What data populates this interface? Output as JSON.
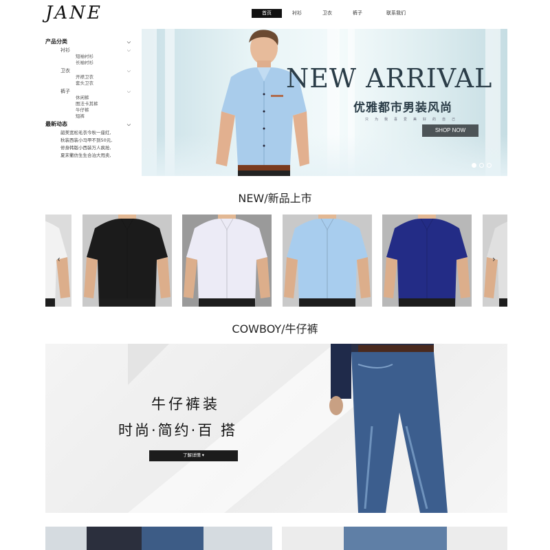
{
  "logo": "JANE",
  "nav": {
    "items": [
      {
        "label": "首页",
        "active": true
      },
      {
        "label": "衬衫",
        "active": false
      },
      {
        "label": "卫衣",
        "active": false
      },
      {
        "label": "裤子",
        "active": false
      },
      {
        "label": "联系我们",
        "active": false
      }
    ]
  },
  "sidebar": {
    "products_title": "产品分类",
    "categories": [
      {
        "label": "衬衫",
        "items": [
          "短袖衬衫",
          "长袖衬衫"
        ]
      },
      {
        "label": "卫衣",
        "items": [
          "开襟卫衣",
          "套头卫衣"
        ]
      },
      {
        "label": "裤子",
        "items": [
          "休闲裤",
          "图法卡其裤",
          "牛仔裤",
          "短裤"
        ]
      }
    ],
    "news_title": "最新动态",
    "news": [
      "韶美宽松毛衣今秋一座红,",
      "秋装西装小马甲不到50元,",
      "修身韩版小西装万人疯抢,",
      "夏末衢仿生生合泊大甩卖,"
    ]
  },
  "banner": {
    "title": "NEW ARRIVAL",
    "subtitle": "优雅都市男装风尚",
    "small_text": "只为我喜爱美好的自己",
    "button": "SHOP NOW"
  },
  "sections": {
    "new_title": "NEW/新品上市",
    "cowboy_title": "COWBOY/牛仔裤"
  },
  "carousel": {
    "shirts": [
      {
        "color": "#f2f2f2",
        "bg": "#dcdcdc"
      },
      {
        "color": "#1b1b1b",
        "bg": "#c9c9c9"
      },
      {
        "color": "#ecebf6",
        "bg": "#9a9a9a"
      },
      {
        "color": "#a8cdee",
        "bg": "#c9c9c9"
      },
      {
        "color": "#232c86",
        "bg": "#b8b8b8"
      },
      {
        "color": "#e0e0e0",
        "bg": "#d0d0d0"
      }
    ],
    "prev_icon": "‹",
    "next_icon": "›"
  },
  "cowboy": {
    "title": "牛仔裤装",
    "subtitle": "时尚·简约·百 搭",
    "button": "了解详情 ▾"
  }
}
